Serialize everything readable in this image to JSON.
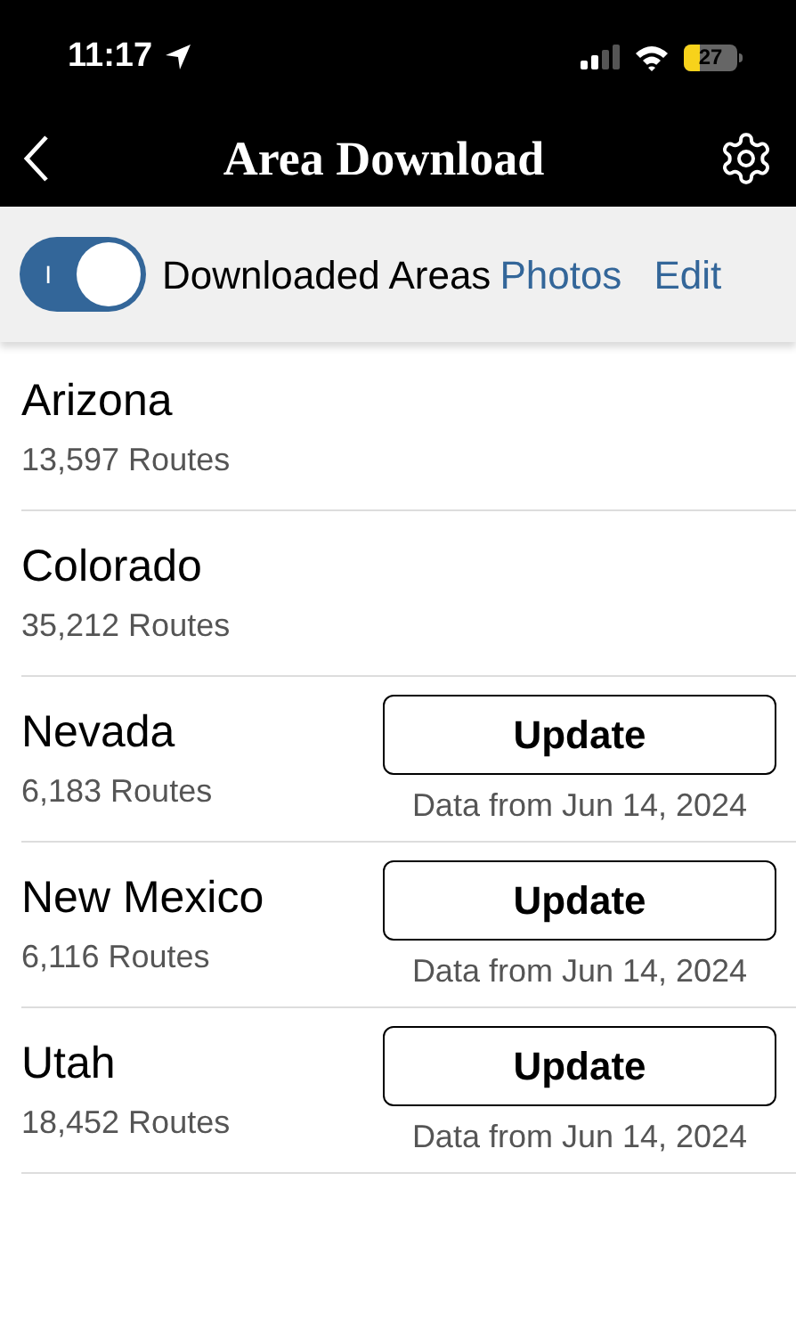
{
  "status_bar": {
    "time": "11:17",
    "battery": "27"
  },
  "nav": {
    "title": "Area Download"
  },
  "toolbar": {
    "toggle": {
      "label": "Downloaded Areas",
      "on": true,
      "glyph": "I"
    },
    "links": [
      "Photos",
      "Edit"
    ]
  },
  "areas": [
    {
      "kind": "plain",
      "name": "Arizona",
      "routes": "13,597 Routes"
    },
    {
      "kind": "plain",
      "name": "Colorado",
      "routes": "35,212 Routes"
    },
    {
      "kind": "update",
      "name": "Nevada",
      "routes": "6,183 Routes",
      "button": "Update",
      "date": "Data from Jun 14, 2024"
    },
    {
      "kind": "update",
      "name": "New Mexico",
      "routes": "6,116 Routes",
      "button": "Update",
      "date": "Data from Jun 14, 2024"
    },
    {
      "kind": "update",
      "name": "Utah",
      "routes": "18,452 Routes",
      "button": "Update",
      "date": "Data from Jun 14, 2024"
    }
  ]
}
